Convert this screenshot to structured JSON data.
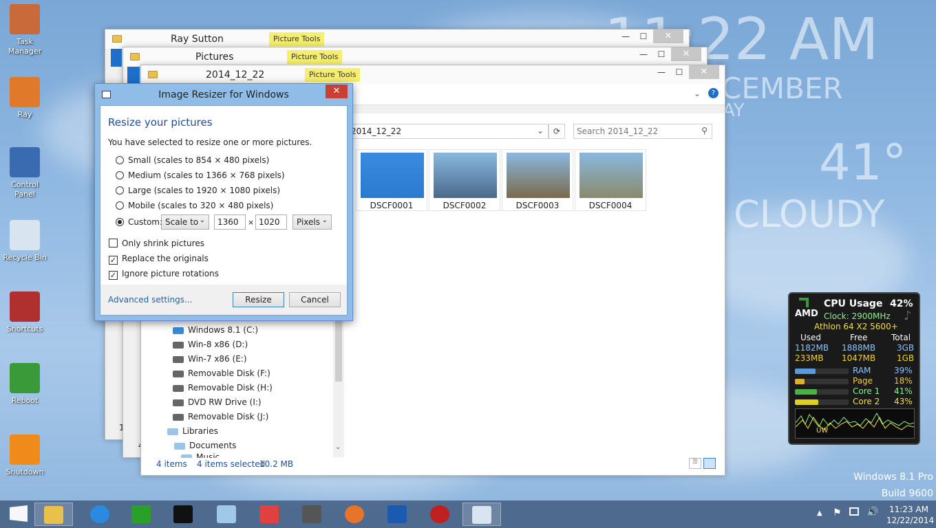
{
  "desktop": {
    "icons": [
      {
        "name": "task-manager",
        "label": "Task\nManager",
        "color": "#c86a3a"
      },
      {
        "name": "ray",
        "label": "Ray",
        "color": "#e07a2a"
      },
      {
        "name": "control-panel",
        "label": "Control\nPanel",
        "color": "#3a6ab0"
      },
      {
        "name": "recycle-bin",
        "label": "Recycle Bin",
        "color": "#d8e4f0"
      },
      {
        "name": "shortcuts",
        "label": "Shortcuts",
        "color": "#b03030"
      },
      {
        "name": "reboot",
        "label": "Reboot",
        "color": "#3a9a3a"
      },
      {
        "name": "shutdown",
        "label": "Shutdown",
        "color": "#f08a1a"
      }
    ],
    "clock_widget": {
      "time": "11:22 AM",
      "date_partial": "CEMBER",
      "day_partial": "AY"
    },
    "weather_widget": {
      "temp": "41°",
      "condition": "CLOUDY"
    },
    "os_info": {
      "edition": "Windows 8.1 Pro",
      "build": "Build 9600"
    }
  },
  "windows": [
    {
      "title": "Ray Sutton",
      "tools": "Picture Tools"
    },
    {
      "title": "Pictures",
      "tools": "Picture Tools"
    },
    {
      "title": "2014_12_22",
      "tools": "Picture Tools"
    }
  ],
  "explorer": {
    "address": "2014_12_22",
    "search_placeholder": "Search 2014_12_22",
    "thumbnails": [
      {
        "label": "DSCF0001",
        "color": "#2a7ad0"
      },
      {
        "label": "DSCF0002",
        "color": "#4a6a8a"
      },
      {
        "label": "DSCF0003",
        "color": "#7a6a4a"
      },
      {
        "label": "DSCF0004",
        "color": "#8a8a6a"
      }
    ],
    "tree": [
      "Windows 8.1 (C:)",
      "Win-8 x86 (D:)",
      "Win-7 x86 (E:)",
      "Removable Disk (F:)",
      "Removable Disk (H:)",
      "DVD RW Drive (I:)",
      "Removable Disk (J:)",
      "Libraries",
      "Documents",
      "Music"
    ],
    "status": {
      "items": "4 items",
      "selected": "4 items selected",
      "size": "10.2 MB"
    },
    "back_status": {
      "w1": "1",
      "w2": "4"
    }
  },
  "dialog": {
    "title": "Image Resizer for Windows",
    "heading": "Resize your pictures",
    "subheading": "You have selected to resize one or more pictures.",
    "options": [
      {
        "label": "Small (scales to 854 × 480 pixels)",
        "selected": false
      },
      {
        "label": "Medium (scales to 1366 × 768 pixels)",
        "selected": false
      },
      {
        "label": "Large (scales to 1920 × 1080 pixels)",
        "selected": false
      },
      {
        "label": "Mobile (scales to 320 × 480 pixels)",
        "selected": false
      },
      {
        "label": "Custom:",
        "selected": true
      }
    ],
    "custom": {
      "mode": "Scale to",
      "width": "1360",
      "times": "×",
      "height": "1020",
      "unit": "Pixels"
    },
    "checks": [
      {
        "label": "Only shrink pictures",
        "checked": false
      },
      {
        "label": "Replace the originals",
        "checked": true
      },
      {
        "label": "Ignore picture rotations",
        "checked": true
      }
    ],
    "advanced": "Advanced settings...",
    "resize": "Resize",
    "cancel": "Cancel"
  },
  "cpu_gadget": {
    "brand": "AMD",
    "title": "CPU Usage",
    "percent": "42%",
    "clock": "Clock: 2900MHz",
    "model": "Athlon 64 X2 5600+",
    "headers": [
      "Used",
      "Free",
      "Total"
    ],
    "row1": [
      "1182MB",
      "1888MB",
      "3GB"
    ],
    "row2": [
      "233MB",
      "1047MB",
      "1GB"
    ],
    "meters": [
      {
        "label": "RAM",
        "value": "39%",
        "fill": 0.39,
        "color": "#5a9ad8",
        "text": "#8cc4ff"
      },
      {
        "label": "Page",
        "value": "18%",
        "fill": 0.18,
        "color": "#e0b020",
        "text": "#f0d030"
      },
      {
        "label": "Core 1",
        "value": "41%",
        "fill": 0.41,
        "color": "#4ab04a",
        "text": "#8ef08e"
      },
      {
        "label": "Core 2",
        "value": "43%",
        "fill": 0.43,
        "color": "#e0d020",
        "text": "#f0e040"
      }
    ],
    "graph_label": "UW"
  },
  "taskbar": {
    "apps": [
      {
        "name": "start",
        "color": "#ffffff"
      },
      {
        "name": "file-explorer",
        "color": "#e8c04a"
      },
      {
        "name": "internet-explorer",
        "color": "#2a8ae0"
      },
      {
        "name": "store",
        "color": "#2aa02a"
      },
      {
        "name": "command-prompt",
        "color": "#111111"
      },
      {
        "name": "notepad",
        "color": "#a0c8e8"
      },
      {
        "name": "snipping-tool",
        "color": "#e04040"
      },
      {
        "name": "camera",
        "color": "#555555"
      },
      {
        "name": "firefox",
        "color": "#e8742a"
      },
      {
        "name": "malwarebytes",
        "color": "#1a5ab0"
      },
      {
        "name": "no-entry",
        "color": "#c02020"
      },
      {
        "name": "image-resizer",
        "color": "#d8e4f0"
      }
    ],
    "time": "11:23 AM",
    "date": "12/22/2014"
  }
}
